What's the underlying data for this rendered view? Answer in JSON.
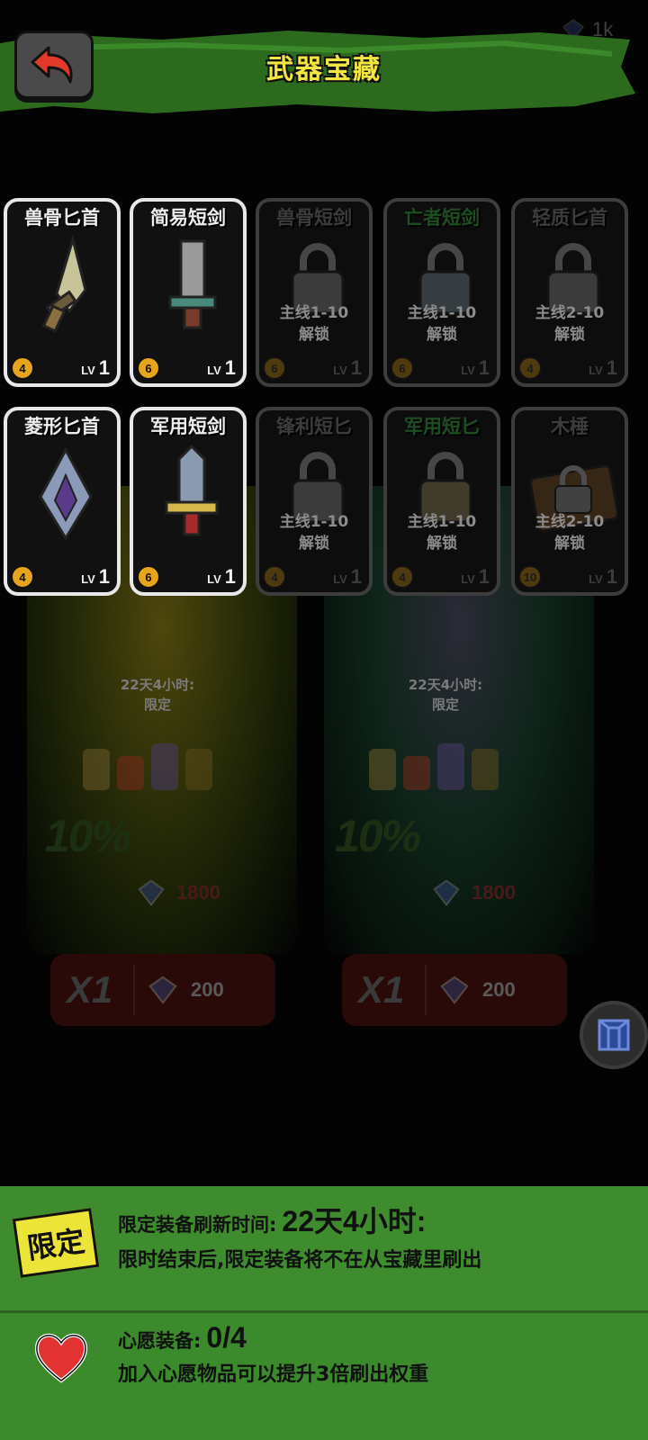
{
  "header": {
    "title": "武器宝藏",
    "gem_count": "1k"
  },
  "weapons": [
    {
      "name": "兽骨匕首",
      "rarity": "4",
      "lv_label": "LV",
      "level": "1",
      "locked": false,
      "unlock": ""
    },
    {
      "name": "简易短剑",
      "rarity": "6",
      "lv_label": "LV",
      "level": "1",
      "locked": false,
      "unlock": ""
    },
    {
      "name": "兽骨短剑",
      "rarity": "6",
      "lv_label": "LV",
      "level": "1",
      "locked": true,
      "unlock": "主线1-10\n解锁"
    },
    {
      "name": "亡者短剑",
      "rarity": "6",
      "lv_label": "LV",
      "level": "1",
      "locked": true,
      "unlock": "主线1-10\n解锁"
    },
    {
      "name": "轻质匕首",
      "rarity": "4",
      "lv_label": "LV",
      "level": "1",
      "locked": true,
      "unlock": "主线2-10\n解锁"
    },
    {
      "name": "菱形匕首",
      "rarity": "4",
      "lv_label": "LV",
      "level": "1",
      "locked": false,
      "unlock": ""
    },
    {
      "name": "军用短剑",
      "rarity": "6",
      "lv_label": "LV",
      "level": "1",
      "locked": false,
      "unlock": ""
    },
    {
      "name": "锋利短匕",
      "rarity": "4",
      "lv_label": "LV",
      "level": "1",
      "locked": true,
      "unlock": "主线1-10\n解锁"
    },
    {
      "name": "军用短匕",
      "rarity": "4",
      "lv_label": "LV",
      "level": "1",
      "locked": true,
      "unlock": "主线1-10\n解锁"
    },
    {
      "name": "木棰",
      "rarity": "10",
      "lv_label": "LV",
      "level": "1",
      "locked": true,
      "unlock": "主线2-10\n解锁"
    }
  ],
  "chests": [
    {
      "timer_line1": "22天4小时:",
      "timer_line2": "限定",
      "discount": "10%",
      "old_price": "1800",
      "qty": "X1",
      "price": "200"
    },
    {
      "timer_line1": "22天4小时:",
      "timer_line2": "限定",
      "discount": "10%",
      "old_price": "1800",
      "qty": "X1",
      "price": "200"
    }
  ],
  "limited_panel": {
    "badge": "限定",
    "label": "限定装备刷新时间:",
    "time": "22天4小时:",
    "desc": "限时结束后,限定装备将不在从宝藏里刷出"
  },
  "wish_panel": {
    "label": "心愿装备:",
    "count": "0/4",
    "desc": "加入心愿物品可以提升3倍刷出权重"
  },
  "colors": {
    "title_yellow": "#f2e640",
    "panel_green": "#3e8c2e",
    "rarity_orange": "#e8a41a"
  }
}
